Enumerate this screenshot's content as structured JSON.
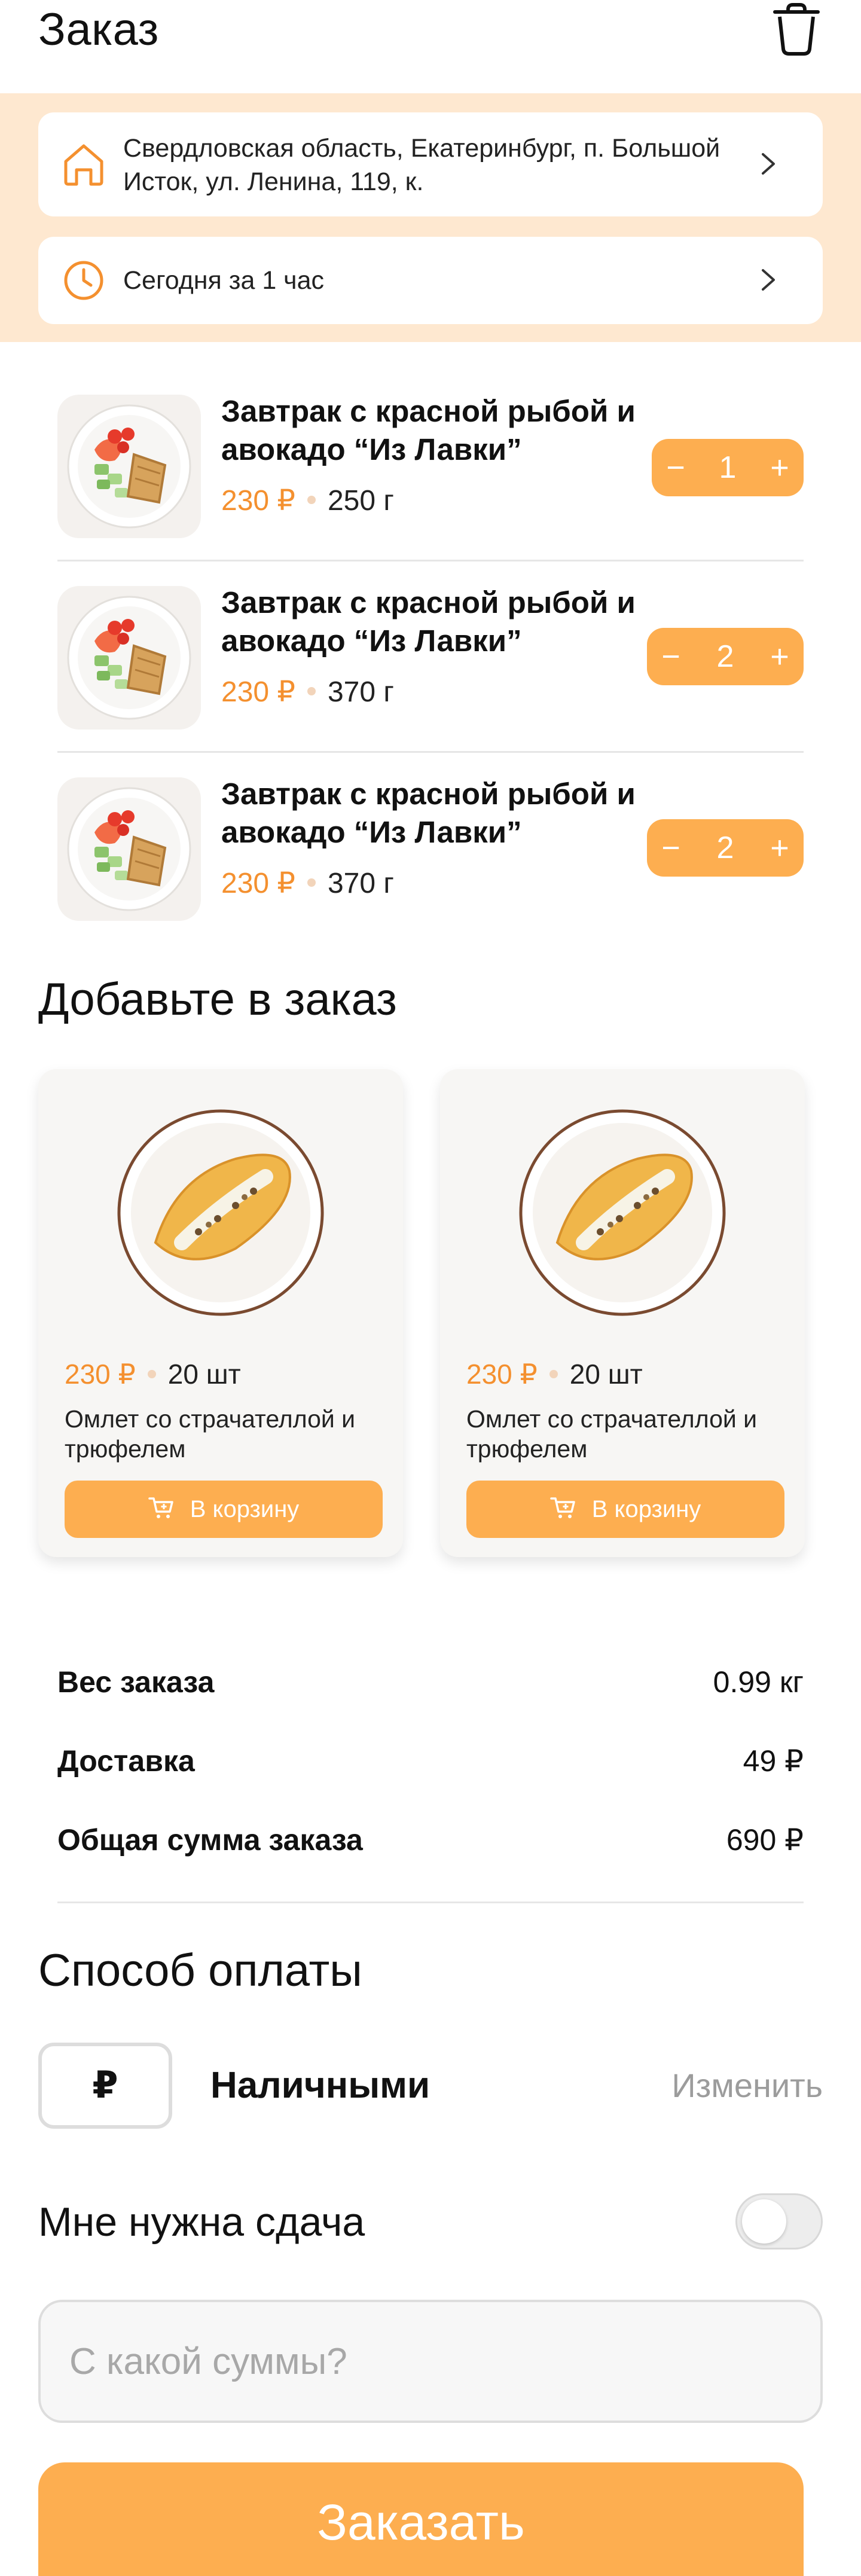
{
  "header": {
    "title": "Заказ",
    "trash_icon": "trash-icon"
  },
  "delivery": {
    "address": "Свердловская область, Екатеринбург, п. Большой Исток, ул. Ленина, 119, к.",
    "time": "Сегодня за 1 час",
    "address_icon": "home-icon",
    "time_icon": "clock-icon",
    "chevron_icon": "chevron-right-icon"
  },
  "cart": {
    "items": [
      {
        "name": "Завтрак с красной рыбой и авокадо “Из Лавки”",
        "price": "230 ₽",
        "weight": "250 г",
        "qty": "1"
      },
      {
        "name": "Завтрак с красной рыбой и авокадо “Из Лавки”",
        "price": "230 ₽",
        "weight": "370 г",
        "qty": "2"
      },
      {
        "name": "Завтрак с красной рыбой и авокадо “Из Лавки”",
        "price": "230 ₽",
        "weight": "370 г",
        "qty": "2"
      }
    ],
    "minus": "−",
    "plus": "+"
  },
  "suggestions": {
    "title": "Добавьте в заказ",
    "items": [
      {
        "price": "230 ₽",
        "count": "20 шт",
        "name": "Омлет со страчателлой и трюфелем",
        "button": "В корзину"
      },
      {
        "price": "230 ₽",
        "count": "20 шт",
        "name": "Омлет со страчателлой и трюфелем",
        "button": "В корзину"
      }
    ]
  },
  "summary": {
    "rows": [
      {
        "label": "Вес заказа",
        "value": "0.99 кг"
      },
      {
        "label": "Доставка",
        "value": "49 ₽"
      },
      {
        "label": "Общая сумма заказа",
        "value": "690 ₽"
      }
    ]
  },
  "payment": {
    "title": "Способ оплаты",
    "symbol": "₽",
    "method": "Наличными",
    "change_link": "Изменить"
  },
  "change": {
    "label": "Мне нужна сдача",
    "toggle_on": false,
    "placeholder": "С какой суммы?"
  },
  "order_button": "Заказать",
  "colors": {
    "accent": "#FDAE50",
    "price": "#F4902F",
    "band": "#FEE8D0"
  }
}
